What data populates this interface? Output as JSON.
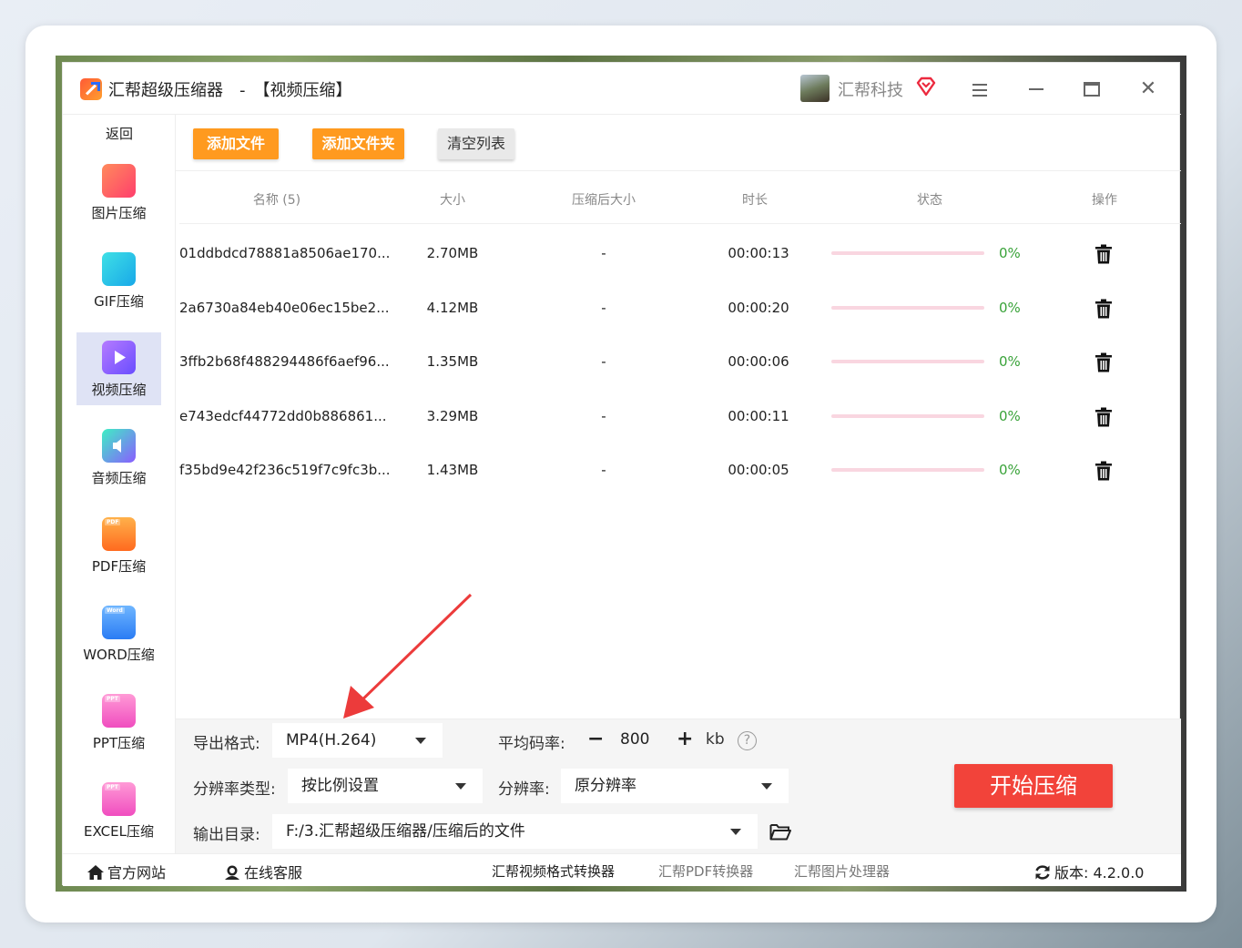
{
  "app": {
    "title": "汇帮超级压缩器　-　【视频压缩】",
    "user_name": "汇帮科技"
  },
  "sidebar": {
    "back_label": "返回",
    "items": [
      {
        "label": "图片压缩",
        "icon": "image-compress-icon",
        "active": false
      },
      {
        "label": "GIF压缩",
        "icon": "gif-compress-icon",
        "active": false
      },
      {
        "label": "视频压缩",
        "icon": "video-compress-icon",
        "active": true
      },
      {
        "label": "音频压缩",
        "icon": "audio-compress-icon",
        "active": false
      },
      {
        "label": "PDF压缩",
        "icon": "pdf-compress-icon",
        "active": false
      },
      {
        "label": "WORD压缩",
        "icon": "word-compress-icon",
        "active": false
      },
      {
        "label": "PPT压缩",
        "icon": "ppt-compress-icon",
        "active": false
      },
      {
        "label": "EXCEL压缩",
        "icon": "excel-compress-icon",
        "active": false
      }
    ],
    "tags": {
      "pdf": "PDF",
      "word": "Word",
      "ppt": "PPT",
      "excel": "PPT"
    }
  },
  "toolbar": {
    "add_file": "添加文件",
    "add_folder": "添加文件夹",
    "clear_list": "清空列表"
  },
  "table": {
    "headers": {
      "name": "名称 (5)",
      "size": "大小",
      "compressed_size": "压缩后大小",
      "duration": "时长",
      "status": "状态",
      "action": "操作"
    },
    "rows": [
      {
        "name": "01ddbdcd78881a8506ae170...",
        "size": "2.70MB",
        "compressed": "-",
        "duration": "00:00:13",
        "progress": 0,
        "percent": "0%"
      },
      {
        "name": "2a6730a84eb40e06ec15be2...",
        "size": "4.12MB",
        "compressed": "-",
        "duration": "00:00:20",
        "progress": 0,
        "percent": "0%"
      },
      {
        "name": "3ffb2b68f488294486f6aef96...",
        "size": "1.35MB",
        "compressed": "-",
        "duration": "00:00:06",
        "progress": 0,
        "percent": "0%"
      },
      {
        "name": "e743edcf44772dd0b886861...",
        "size": "3.29MB",
        "compressed": "-",
        "duration": "00:00:11",
        "progress": 0,
        "percent": "0%"
      },
      {
        "name": "f35bd9e42f236c519f7c9fc3b...",
        "size": "1.43MB",
        "compressed": "-",
        "duration": "00:00:05",
        "progress": 0,
        "percent": "0%"
      }
    ]
  },
  "settings": {
    "format_label": "导出格式:",
    "format_value": "MP4(H.264)",
    "bitrate_label": "平均码率:",
    "bitrate_minus": "−",
    "bitrate_value": "800",
    "bitrate_plus": "+",
    "bitrate_unit": "kb",
    "help": "?",
    "res_type_label": "分辨率类型:",
    "res_type_value": "按比例设置",
    "res_label": "分辨率:",
    "res_value": "原分辨率",
    "output_label": "输出目录:",
    "output_value": "F:/3.汇帮超级压缩器/压缩后的文件",
    "start_button": "开始压缩"
  },
  "footer": {
    "website": "官方网站",
    "support": "在线客服",
    "link1": "汇帮视频格式转换器",
    "link2": "汇帮PDF转换器",
    "link3": "汇帮图片处理器",
    "version": "版本:  4.2.0.0"
  },
  "colors": {
    "accent_orange": "#ff9a1f",
    "start_red": "#f2433a",
    "progress_track": "#f9d6e0",
    "percent_green": "#3aa33a",
    "active_sidebar": "#dfe3f5",
    "annotation_arrow": "#ec3b3b"
  }
}
